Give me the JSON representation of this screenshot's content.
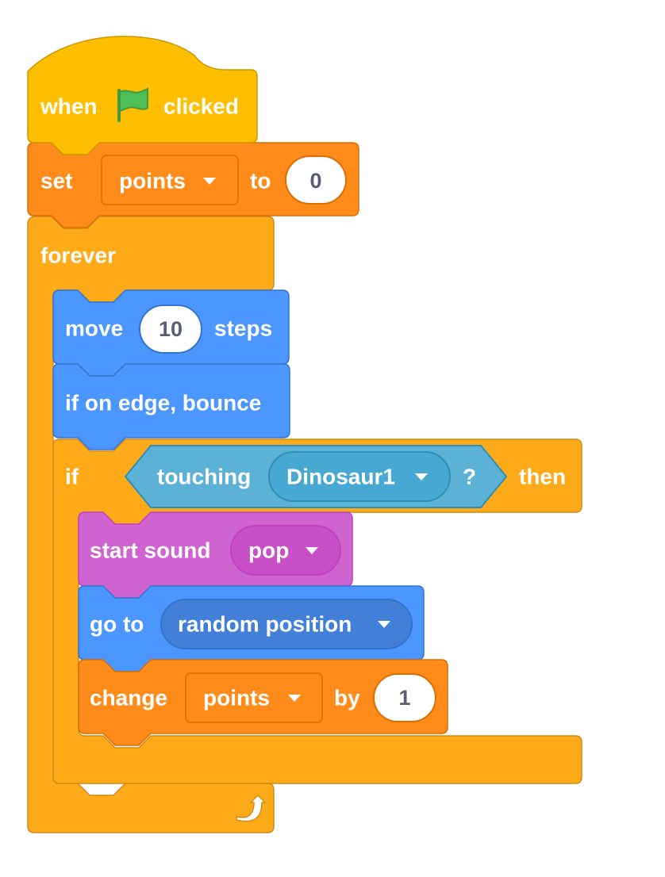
{
  "colors": {
    "events": "#FFBF00",
    "events_border": "#CC9900",
    "variables": "#FF8C1A",
    "variables_border": "#DB6E00",
    "control": "#FFAB19",
    "control_border": "#CF8B17",
    "motion": "#4C97FF",
    "motion_border": "#3373CC",
    "sensing": "#5CB1D6",
    "sensing_border": "#2E8EB8",
    "sound": "#CF63CF",
    "sound_border": "#BD42BD",
    "flag": "#4CBF56"
  },
  "hat": {
    "when": "when",
    "clicked": "clicked",
    "flag_icon": "green-flag-icon"
  },
  "set_block": {
    "label": "set",
    "variable": "points",
    "to": "to",
    "value": "0"
  },
  "forever_block": {
    "label": "forever",
    "loop_icon": "loop-arrow-icon"
  },
  "move_block": {
    "label": "move",
    "steps_value": "10",
    "steps": "steps"
  },
  "bounce_block": {
    "label": "if on edge, bounce"
  },
  "if_block": {
    "label": "if",
    "then": "then",
    "condition": {
      "label": "touching",
      "target": "Dinosaur1",
      "question": "?"
    }
  },
  "sound_block": {
    "label": "start sound",
    "sound": "pop"
  },
  "goto_block": {
    "label": "go to",
    "target": "random position"
  },
  "change_block": {
    "label": "change",
    "variable": "points",
    "by": "by",
    "value": "1"
  }
}
